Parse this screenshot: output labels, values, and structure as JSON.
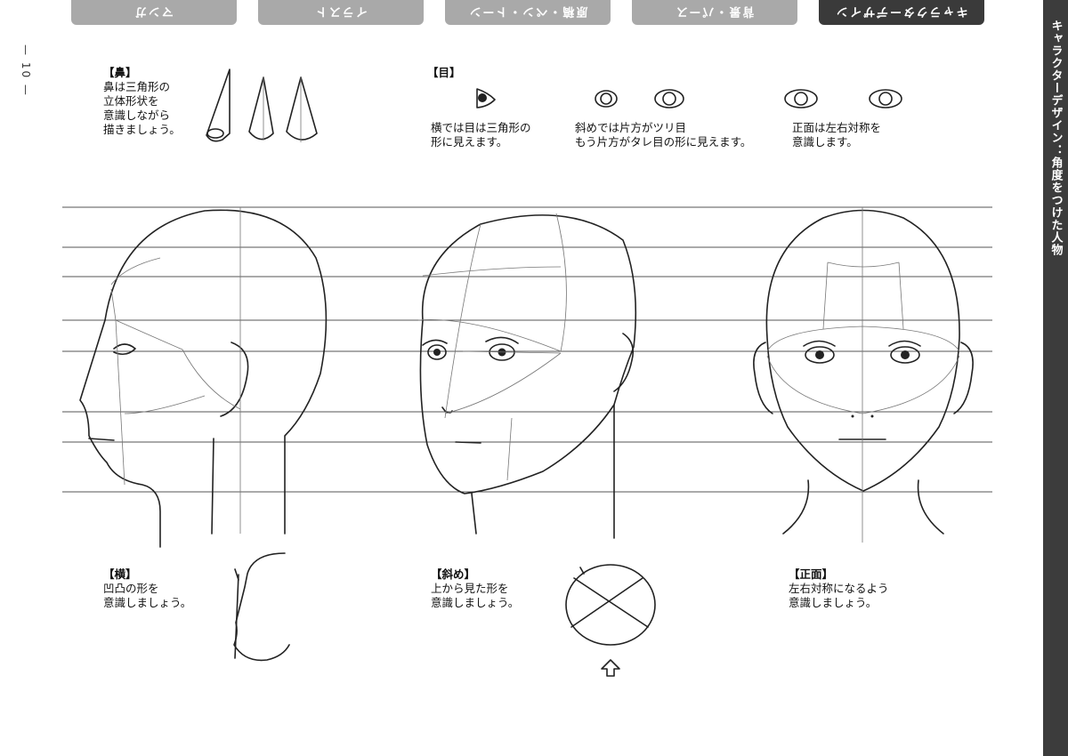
{
  "page_number": "— 10 —",
  "tabs": [
    {
      "label": "マンガ",
      "active": false
    },
    {
      "label": "イラスト",
      "active": false
    },
    {
      "label": "原稿・ペン・トーン",
      "active": false
    },
    {
      "label": "背景・パース",
      "active": false
    },
    {
      "label": "キャラクターデザイン",
      "active": true
    }
  ],
  "side_title": "キャラクターデザイン：角度をつけた人物",
  "notes": {
    "nose": {
      "heading": "【鼻】",
      "lines": [
        "鼻は三角形の",
        "立体形状を",
        "意識しながら",
        "描きましょう。"
      ]
    },
    "eyes": {
      "heading": "【目】"
    },
    "eyes_side": {
      "lines": [
        "横では目は三角形の",
        "形に見えます。"
      ]
    },
    "eyes_diag": {
      "lines": [
        "斜めでは片方がツリ目",
        "もう片方がタレ目の形に見えます。"
      ]
    },
    "eyes_front": {
      "lines": [
        "正面は左右対称を",
        "意識します。"
      ]
    },
    "side": {
      "heading": "【横】",
      "lines": [
        "凹凸の形を",
        "意識しましょう。"
      ]
    },
    "diag": {
      "heading": "【斜め】",
      "lines": [
        "上から見た形を",
        "意識しましょう。"
      ]
    },
    "front": {
      "heading": "【正面】",
      "lines": [
        "左右対称になるよう",
        "意識しましょう。"
      ]
    }
  },
  "colors": {
    "tab": "#a9a9a9",
    "tab_active": "#3a3a3a",
    "side_bar": "#3c3c3c"
  }
}
